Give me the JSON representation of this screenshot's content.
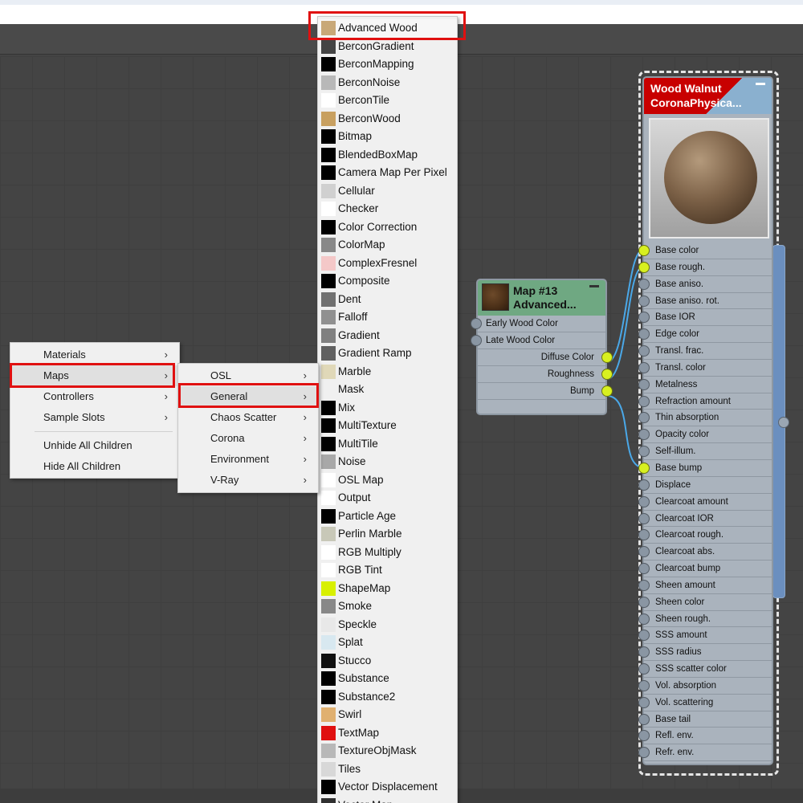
{
  "context_menu": {
    "items": [
      {
        "label": "Materials",
        "has_submenu": true
      },
      {
        "label": "Maps",
        "has_submenu": true
      },
      {
        "label": "Controllers",
        "has_submenu": true
      },
      {
        "label": "Sample Slots",
        "has_submenu": true
      },
      {
        "label": "Unhide All Children",
        "has_submenu": false
      },
      {
        "label": "Hide All Children",
        "has_submenu": false
      }
    ]
  },
  "maps_submenu": {
    "items": [
      {
        "label": "OSL"
      },
      {
        "label": "General"
      },
      {
        "label": "Chaos Scatter"
      },
      {
        "label": "Corona"
      },
      {
        "label": "Environment"
      },
      {
        "label": "V-Ray"
      }
    ]
  },
  "general_maps": {
    "items": [
      {
        "label": "Advanced Wood",
        "swatch": "#c8a878"
      },
      {
        "label": "BerconGradient",
        "swatch": "#444444"
      },
      {
        "label": "BerconMapping",
        "swatch": "#000000"
      },
      {
        "label": "BerconNoise",
        "swatch": "#b8b8b8"
      },
      {
        "label": "BerconTile",
        "swatch": "#ffffff"
      },
      {
        "label": "BerconWood",
        "swatch": "#c8a060"
      },
      {
        "label": "Bitmap",
        "swatch": "#000000"
      },
      {
        "label": "BlendedBoxMap",
        "swatch": "#000000"
      },
      {
        "label": "Camera Map Per Pixel",
        "swatch": "#000000"
      },
      {
        "label": "Cellular",
        "swatch": "#d0d0d0"
      },
      {
        "label": "Checker",
        "swatch": "#ffffff"
      },
      {
        "label": "Color Correction",
        "swatch": "#000000"
      },
      {
        "label": "ColorMap",
        "swatch": "#888888"
      },
      {
        "label": "ComplexFresnel",
        "swatch": "#f4c8c8"
      },
      {
        "label": "Composite",
        "swatch": "#000000"
      },
      {
        "label": "Dent",
        "swatch": "#707070"
      },
      {
        "label": "Falloff",
        "swatch": "#909090"
      },
      {
        "label": "Gradient",
        "swatch": "#808080"
      },
      {
        "label": "Gradient Ramp",
        "swatch": "#606060"
      },
      {
        "label": "Marble",
        "swatch": "#e0d8b8"
      },
      {
        "label": "Mask",
        "swatch": "#f0f0f0"
      },
      {
        "label": "Mix",
        "swatch": "#000000"
      },
      {
        "label": "MultiTexture",
        "swatch": "#000000"
      },
      {
        "label": "MultiTile",
        "swatch": "#000000"
      },
      {
        "label": "Noise",
        "swatch": "#a8a8a8"
      },
      {
        "label": "OSL Map",
        "swatch": "#ffffff"
      },
      {
        "label": "Output",
        "swatch": "#ffffff"
      },
      {
        "label": "Particle Age",
        "swatch": "#000000"
      },
      {
        "label": "Perlin Marble",
        "swatch": "#c8c8b8"
      },
      {
        "label": "RGB Multiply",
        "swatch": "#ffffff"
      },
      {
        "label": "RGB Tint",
        "swatch": "#ffffff"
      },
      {
        "label": "ShapeMap",
        "swatch": "#d8f000"
      },
      {
        "label": "Smoke",
        "swatch": "#888888"
      },
      {
        "label": "Speckle",
        "swatch": "#e8e8e8"
      },
      {
        "label": "Splat",
        "swatch": "#d8e8f0"
      },
      {
        "label": "Stucco",
        "swatch": "#101010"
      },
      {
        "label": "Substance",
        "swatch": "#000000"
      },
      {
        "label": "Substance2",
        "swatch": "#000000"
      },
      {
        "label": "Swirl",
        "swatch": "#e0b070"
      },
      {
        "label": "TextMap",
        "swatch": "#e01010"
      },
      {
        "label": "TextureObjMask",
        "swatch": "#b8b8b8"
      },
      {
        "label": "Tiles",
        "swatch": "#d8d8d8"
      },
      {
        "label": "Vector Displacement",
        "swatch": "#000000"
      },
      {
        "label": "Vector Map",
        "swatch": "#303030"
      }
    ]
  },
  "map_node": {
    "title_line1": "Map #13",
    "title_line2": "Advanced...",
    "inputs": [
      "Early Wood Color",
      "Late Wood Color"
    ],
    "outputs": [
      {
        "label": "Diffuse Color",
        "connected": true
      },
      {
        "label": "Roughness",
        "connected": true
      },
      {
        "label": "Bump",
        "connected": true
      }
    ]
  },
  "material_node": {
    "title_line1": "Wood Walnut",
    "title_line2": "CoronaPhysica...",
    "ports": [
      {
        "label": "Base color",
        "connected": true
      },
      {
        "label": "Base rough.",
        "connected": true
      },
      {
        "label": "Base aniso.",
        "connected": false
      },
      {
        "label": "Base aniso. rot.",
        "connected": false
      },
      {
        "label": "Base IOR",
        "connected": false
      },
      {
        "label": "Edge color",
        "connected": false
      },
      {
        "label": "Transl. frac.",
        "connected": false
      },
      {
        "label": "Transl. color",
        "connected": false
      },
      {
        "label": "Metalness",
        "connected": false
      },
      {
        "label": "Refraction amount",
        "connected": false
      },
      {
        "label": "Thin absorption",
        "connected": false
      },
      {
        "label": "Opacity color",
        "connected": false
      },
      {
        "label": "Self-illum.",
        "connected": false
      },
      {
        "label": "Base bump",
        "connected": true
      },
      {
        "label": "Displace",
        "connected": false
      },
      {
        "label": "Clearcoat amount",
        "connected": false
      },
      {
        "label": "Clearcoat IOR",
        "connected": false
      },
      {
        "label": "Clearcoat rough.",
        "connected": false
      },
      {
        "label": "Clearcoat abs.",
        "connected": false
      },
      {
        "label": "Clearcoat bump",
        "connected": false
      },
      {
        "label": "Sheen amount",
        "connected": false
      },
      {
        "label": "Sheen color",
        "connected": false
      },
      {
        "label": "Sheen rough.",
        "connected": false
      },
      {
        "label": "SSS amount",
        "connected": false
      },
      {
        "label": "SSS radius",
        "connected": false
      },
      {
        "label": "SSS scatter color",
        "connected": false
      },
      {
        "label": "Vol. absorption",
        "connected": false
      },
      {
        "label": "Vol. scattering",
        "connected": false
      },
      {
        "label": "Base tail",
        "connected": false
      },
      {
        "label": "Refl. env.",
        "connected": false
      },
      {
        "label": "Refr. env.",
        "connected": false
      }
    ]
  },
  "colors": {
    "highlight": "#e01010",
    "port_active": "#d8f020",
    "wire": "#4aa8e8"
  }
}
